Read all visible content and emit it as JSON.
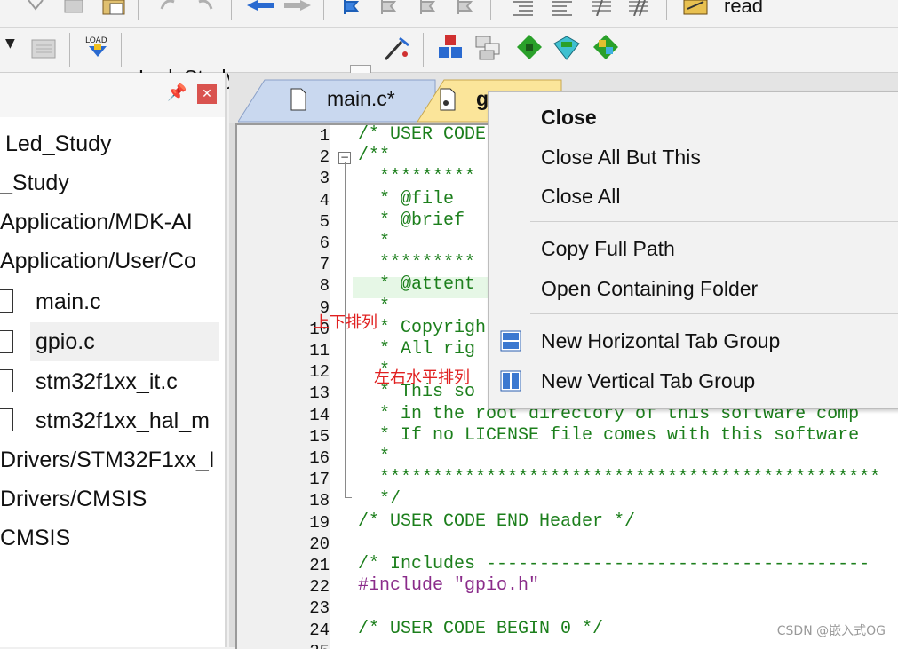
{
  "toolbar_top": {
    "read_label": "read"
  },
  "toolbar_target": {
    "target_name": "Led_Study",
    "target_icons": [
      "load-icon",
      "options-icon",
      "manage-icon",
      "packs-icon",
      "run-icon",
      "debug-icon",
      "components-icon"
    ]
  },
  "project_panel": {
    "items": [
      {
        "label": "Led_Study",
        "type": "target"
      },
      {
        "label": "_Study",
        "type": "group"
      },
      {
        "label": "Application/MDK-AI",
        "type": "group"
      },
      {
        "label": "Application/User/Co",
        "type": "group"
      },
      {
        "label": "main.c",
        "type": "file"
      },
      {
        "label": "gpio.c",
        "type": "file",
        "selected": true
      },
      {
        "label": "stm32f1xx_it.c",
        "type": "file"
      },
      {
        "label": "stm32f1xx_hal_m",
        "type": "file"
      },
      {
        "label": "Drivers/STM32F1xx_I",
        "type": "group"
      },
      {
        "label": "Drivers/CMSIS",
        "type": "group"
      },
      {
        "label": "CMSIS",
        "type": "group"
      }
    ],
    "pin_icon": "pin-icon",
    "close_icon": "close-icon"
  },
  "tabs": [
    {
      "label": "main.c*",
      "active": false
    },
    {
      "label": "gp",
      "active": true
    }
  ],
  "code_lines": [
    {
      "n": "1",
      "text": "/* USER CODE"
    },
    {
      "n": "2",
      "text": "/**"
    },
    {
      "n": "3",
      "text": "  *********"
    },
    {
      "n": "4",
      "text": "  * @file"
    },
    {
      "n": "5",
      "text": "  * @brief"
    },
    {
      "n": "6",
      "text": "  *"
    },
    {
      "n": "7",
      "text": "  *********"
    },
    {
      "n": "8",
      "text": "  * @attent"
    },
    {
      "n": "9",
      "text": "  *"
    },
    {
      "n": "10",
      "text": "  * Copyrigh"
    },
    {
      "n": "11",
      "text": "  * All rig"
    },
    {
      "n": "12",
      "text": "  *"
    },
    {
      "n": "13",
      "text": "  * This so"
    },
    {
      "n": "14",
      "text": "  * in the root directory of this software comp"
    },
    {
      "n": "15",
      "text": "  * If no LICENSE file comes with this software"
    },
    {
      "n": "16",
      "text": "  *"
    },
    {
      "n": "17",
      "text": "  ***********************************************"
    },
    {
      "n": "18",
      "text": "  */"
    },
    {
      "n": "19",
      "text": "/* USER CODE END Header */"
    },
    {
      "n": "20",
      "text": ""
    },
    {
      "n": "21",
      "text": "/* Includes ------------------------------------"
    },
    {
      "n": "22",
      "text": "#include \"gpio.h\""
    },
    {
      "n": "23",
      "text": ""
    },
    {
      "n": "24",
      "text": "/* USER CODE BEGIN 0 */"
    },
    {
      "n": "25",
      "text": ""
    }
  ],
  "annotations": {
    "vertical": "上下排列",
    "horizontal": "左右水平排列"
  },
  "context_menu": {
    "items": [
      {
        "label": "Close",
        "bold": true
      },
      {
        "label": "Close All But This"
      },
      {
        "label": "Close All"
      },
      {
        "label": "Copy Full Path"
      },
      {
        "label": "Open Containing Folder"
      },
      {
        "label": "New Horizontal Tab Group",
        "icon": "horizontal-tab-group-icon"
      },
      {
        "label": "New Vertical Tab Group",
        "icon": "vertical-tab-group-icon"
      }
    ]
  },
  "watermark": "CSDN @嵌入式OG",
  "colors": {
    "comment": "#1c7f1c",
    "preprocessor": "#8a2b8a",
    "annotation": "#e02020",
    "active_tab": "#fbe59a",
    "inactive_tab": "#c9d8ef"
  }
}
